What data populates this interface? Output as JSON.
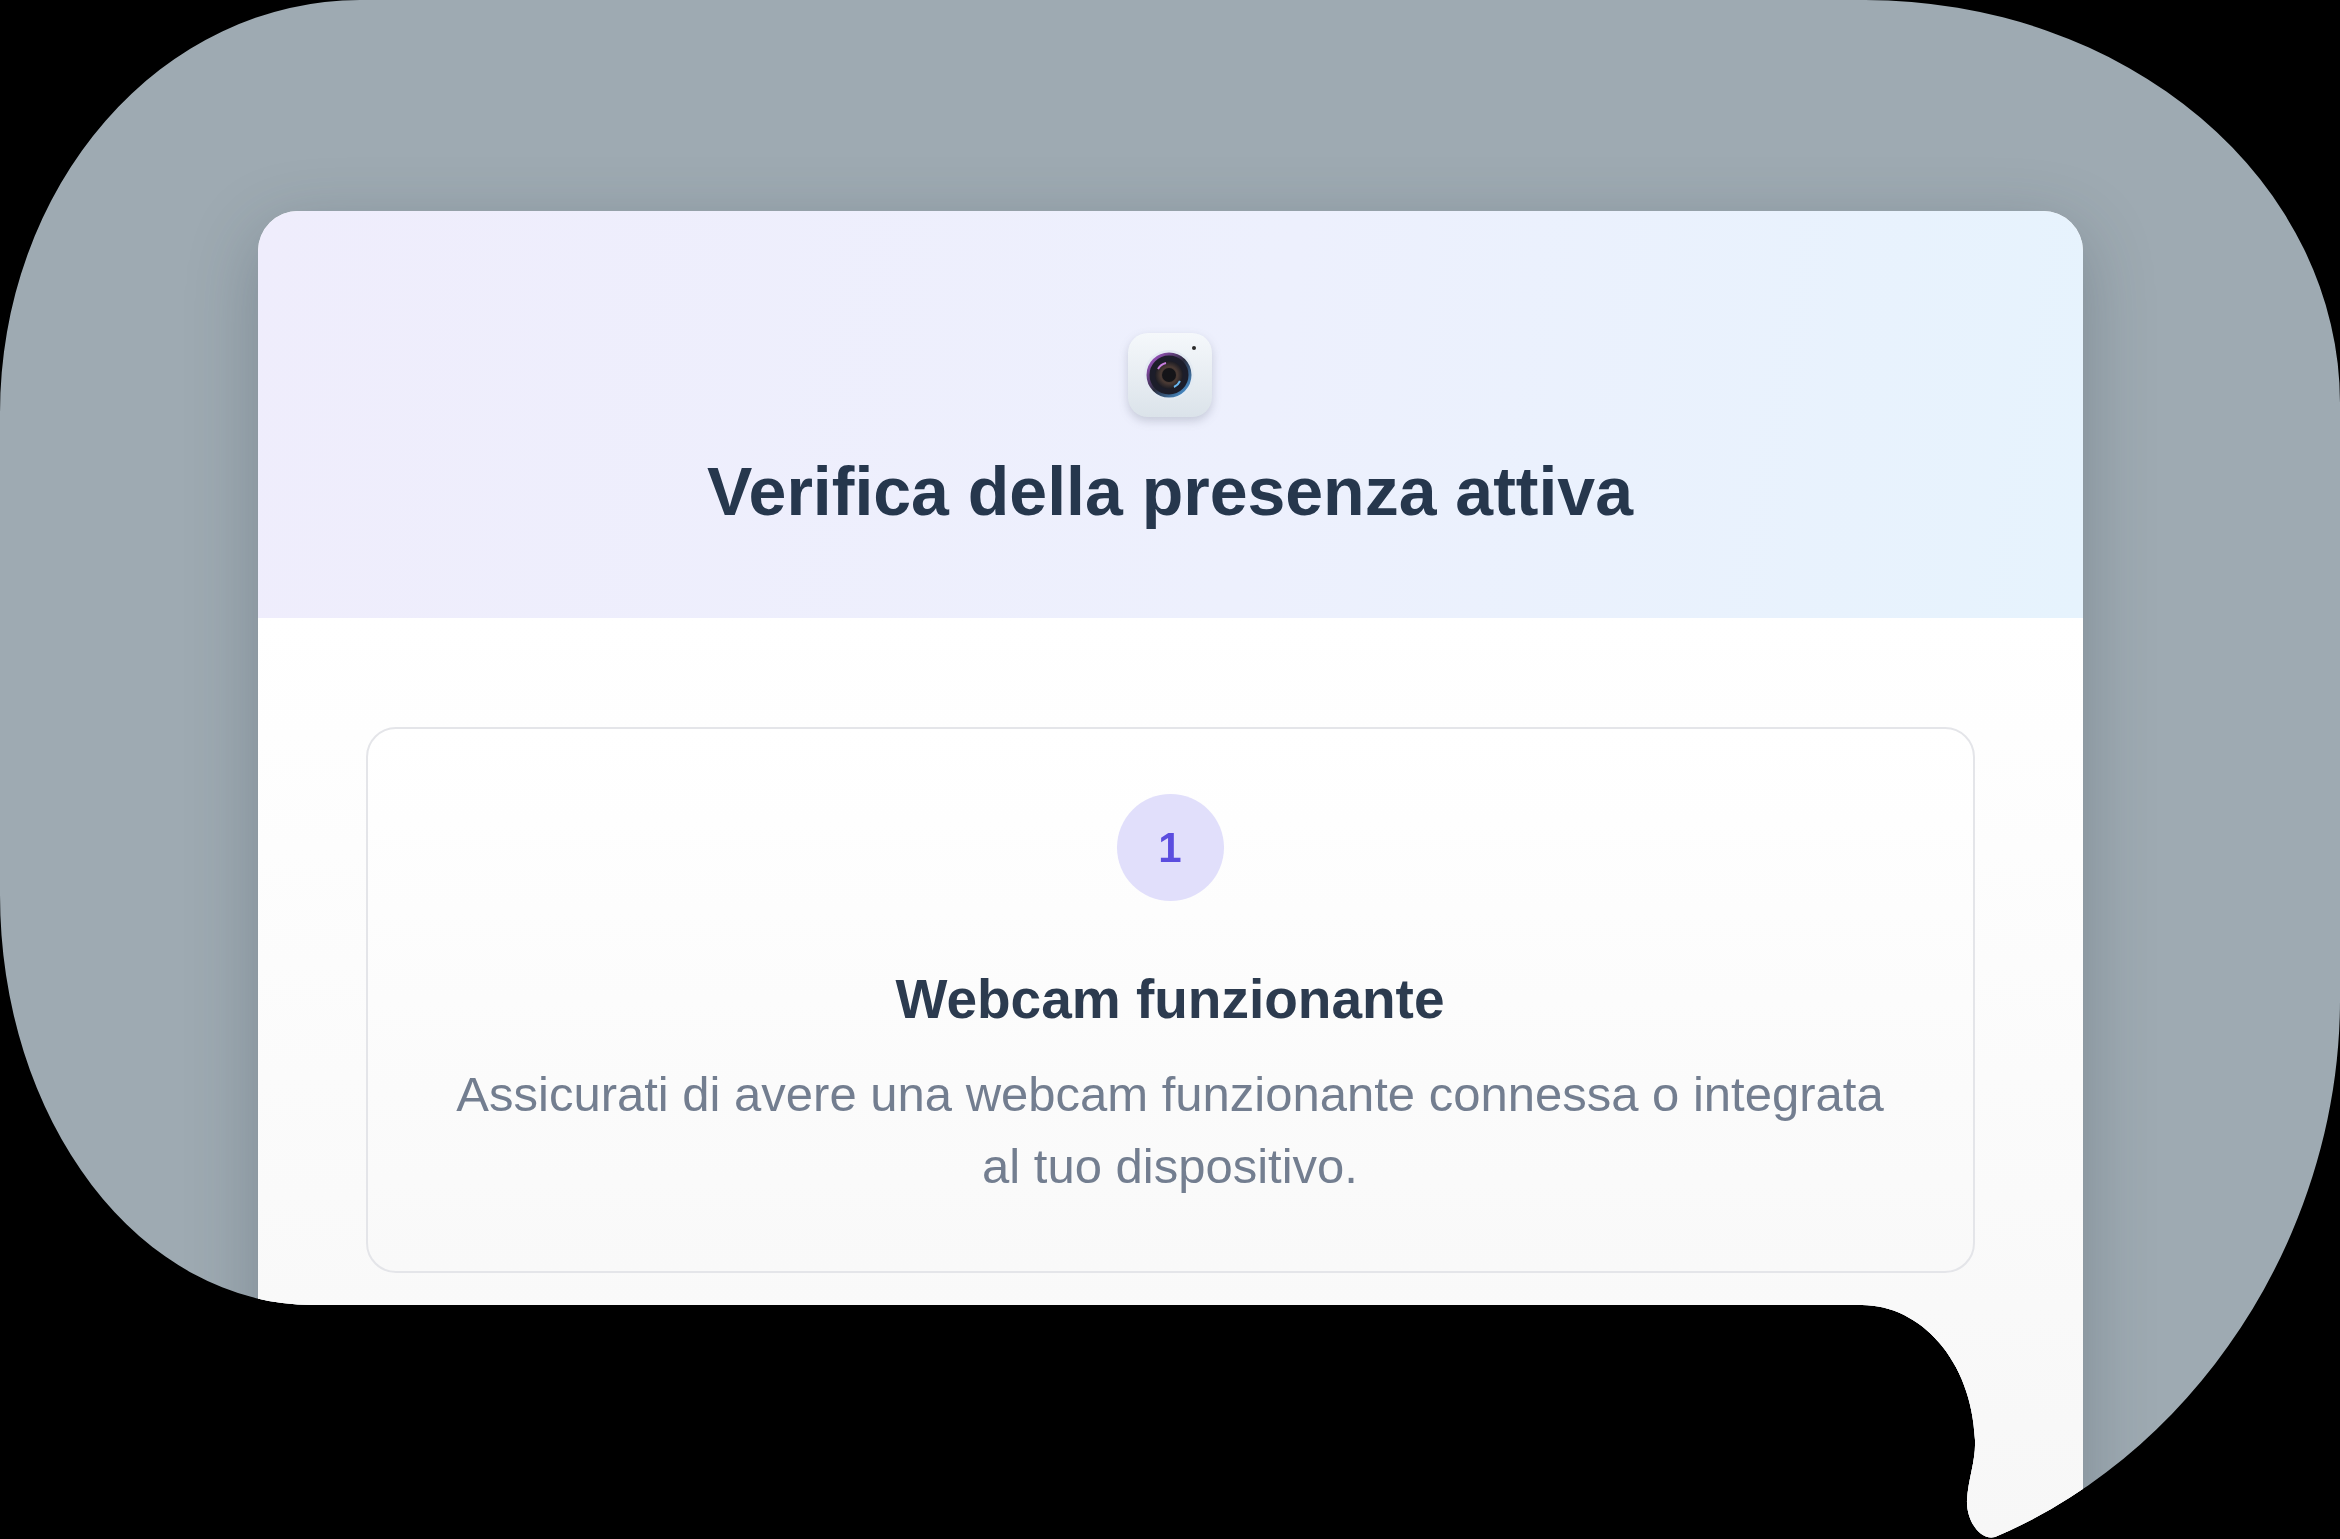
{
  "modal": {
    "title": "Verifica della presenza attiva",
    "steps": [
      {
        "number": "1",
        "title": "Webcam funzionante",
        "description": "Assicurati di avere una webcam funzionante connessa o integrata al tuo dispositivo."
      }
    ]
  }
}
